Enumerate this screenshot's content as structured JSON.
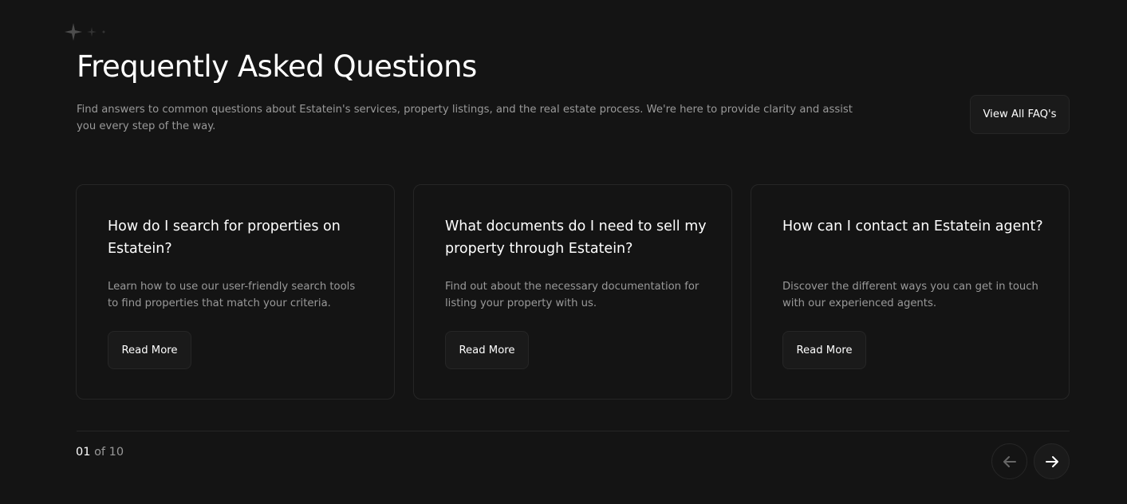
{
  "header": {
    "title": "Frequently Asked Questions",
    "description": "Find answers to common questions about Estatein's services, property listings, and the real estate process. We're here to provide clarity and assist you every step of the way.",
    "view_all_label": "View All FAQ's"
  },
  "faqs": [
    {
      "question": "How do I search for properties on Estatein?",
      "answer": "Learn how to use our user-friendly search tools to find properties that match your criteria.",
      "button_label": "Read More"
    },
    {
      "question": "What documents do I need to sell my property through Estatein?",
      "answer": "Find out about the necessary documentation for listing your property with us.",
      "button_label": "Read More"
    },
    {
      "question": "How can I contact an Estatein agent?",
      "answer": "Discover the different ways you can get in touch with our experienced agents.",
      "button_label": "Read More"
    }
  ],
  "pagination": {
    "current": "01",
    "separator": "of",
    "total": "10"
  },
  "icons": {
    "decoration": "sparkle-icon",
    "previous": "arrow-left-icon",
    "next": "arrow-right-icon"
  },
  "colors": {
    "background": "#141414",
    "card_border": "#262626",
    "button_bg": "#1a1a1a",
    "muted_text": "#999999",
    "text": "#ffffff"
  }
}
